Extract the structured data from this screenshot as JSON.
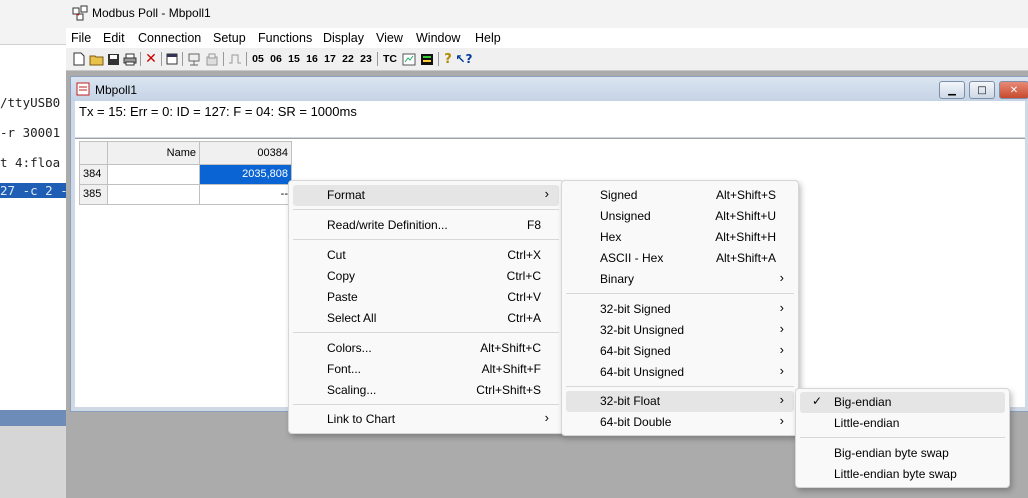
{
  "terminal": {
    "lines": [
      "/ttyUSB0",
      "-r 30001",
      "t 4:floa",
      "27 -c 2 -"
    ]
  },
  "app": {
    "title": "Modbus Poll - Mbpoll1",
    "menu": [
      "File",
      "Edit",
      "Connection",
      "Setup",
      "Functions",
      "Display",
      "View",
      "Window",
      "Help"
    ],
    "toolbar_function_codes": [
      "05",
      "06",
      "15",
      "16",
      "17",
      "22",
      "23"
    ],
    "toolbar_tc": "TC"
  },
  "child_window": {
    "title": "Mbpoll1",
    "status": "Tx = 15: Err = 0: ID = 127: F = 04: SR = 1000ms",
    "grid": {
      "col_headers": [
        "Name",
        "00384"
      ],
      "rows": [
        {
          "row": "384",
          "name": "",
          "value": "2035,808"
        },
        {
          "row": "385",
          "name": "",
          "value": "--"
        }
      ]
    }
  },
  "context_menu": {
    "items": [
      {
        "label": "Format",
        "shortcut": "",
        "submenu": true
      },
      {
        "label": "Read/write Definition...",
        "shortcut": "F8"
      },
      {
        "label": "Cut",
        "shortcut": "Ctrl+X"
      },
      {
        "label": "Copy",
        "shortcut": "Ctrl+C"
      },
      {
        "label": "Paste",
        "shortcut": "Ctrl+V"
      },
      {
        "label": "Select All",
        "shortcut": "Ctrl+A"
      },
      {
        "label": "Colors...",
        "shortcut": "Alt+Shift+C"
      },
      {
        "label": "Font...",
        "shortcut": "Alt+Shift+F"
      },
      {
        "label": "Scaling...",
        "shortcut": "Ctrl+Shift+S"
      },
      {
        "label": "Link to Chart",
        "shortcut": "",
        "submenu": true
      }
    ]
  },
  "format_submenu": {
    "items": [
      {
        "label": "Signed",
        "shortcut": "Alt+Shift+S"
      },
      {
        "label": "Unsigned",
        "shortcut": "Alt+Shift+U"
      },
      {
        "label": "Hex",
        "shortcut": "Alt+Shift+H"
      },
      {
        "label": "ASCII - Hex",
        "shortcut": "Alt+Shift+A"
      },
      {
        "label": "Binary",
        "submenu": true
      },
      {
        "label": "32-bit Signed",
        "submenu": true
      },
      {
        "label": "32-bit Unsigned",
        "submenu": true
      },
      {
        "label": "64-bit Signed",
        "submenu": true
      },
      {
        "label": "64-bit Unsigned",
        "submenu": true
      },
      {
        "label": "32-bit Float",
        "submenu": true
      },
      {
        "label": "64-bit Double",
        "submenu": true
      }
    ]
  },
  "float_submenu": {
    "items": [
      {
        "label": "Big-endian",
        "checked": true
      },
      {
        "label": "Little-endian"
      },
      {
        "label": "Big-endian byte swap"
      },
      {
        "label": "Little-endian byte swap"
      }
    ]
  },
  "colors": {
    "selection": "#0a64d3",
    "menu_highlight": "#e5e5e5",
    "mdi_background": "#ababab"
  }
}
